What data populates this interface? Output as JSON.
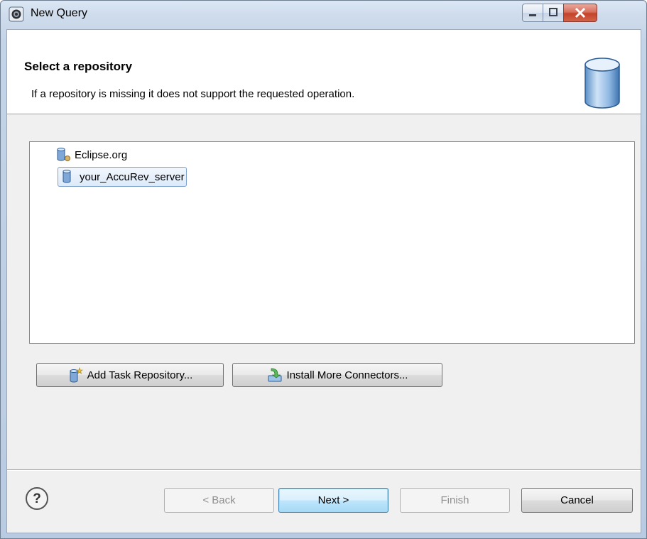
{
  "window": {
    "title": "New Query"
  },
  "header": {
    "title": "Select a repository",
    "description": "If a repository is missing it does not support the requested operation."
  },
  "repositories": [
    {
      "label": "Eclipse.org",
      "selected": false,
      "icon": "repository-web-icon"
    },
    {
      "label": "your_AccuRev_server",
      "selected": true,
      "icon": "repository-icon"
    }
  ],
  "actions": {
    "add_task_repository": "Add Task Repository...",
    "install_connectors": "Install More Connectors..."
  },
  "footer": {
    "back": "< Back",
    "next": "Next >",
    "finish": "Finish",
    "cancel": "Cancel"
  },
  "colors": {
    "selection": "#dceaf9",
    "default_button": "#a7d9f5",
    "close_button": "#c5432a"
  }
}
